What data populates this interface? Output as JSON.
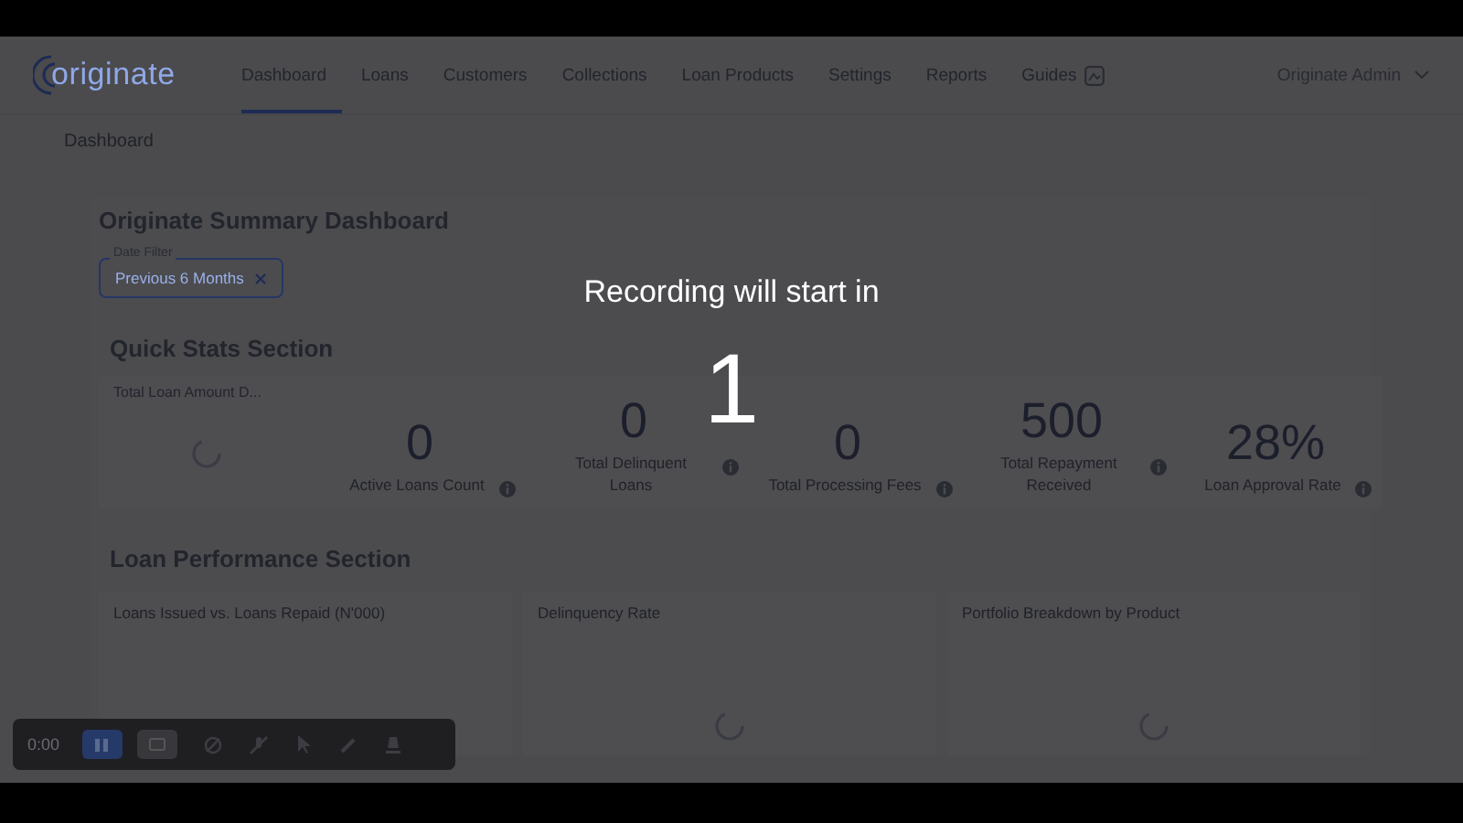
{
  "app": {
    "logo": "originate"
  },
  "nav": [
    {
      "label": "Dashboard",
      "selected": true,
      "has_icon": false
    },
    {
      "label": "Loans",
      "selected": false,
      "has_icon": false
    },
    {
      "label": "Customers",
      "selected": false,
      "has_icon": false
    },
    {
      "label": "Collections",
      "selected": false,
      "has_icon": false
    },
    {
      "label": "Loan Products",
      "selected": false,
      "has_icon": false
    },
    {
      "label": "Settings",
      "selected": false,
      "has_icon": false
    },
    {
      "label": "Reports",
      "selected": false,
      "has_icon": false
    },
    {
      "label": "Guides",
      "selected": false,
      "has_icon": true
    }
  ],
  "user_menu": {
    "label": "Originate Admin"
  },
  "breadcrumb": "Dashboard",
  "page_title": "Originate Summary Dashboard",
  "date_filter": {
    "label": "Date Filter",
    "value": "Previous 6 Months"
  },
  "quick_stats": {
    "title": "Quick Stats Section",
    "loading_card": {
      "title": "Total Loan Amount D..."
    },
    "stats": [
      {
        "value": "0",
        "label": "Active Loans Count"
      },
      {
        "value": "0",
        "label": "Total Delinquent Loans"
      },
      {
        "value": "0",
        "label": "Total Processing Fees"
      },
      {
        "value": "500",
        "label": "Total Repayment Received"
      },
      {
        "value": "28%",
        "label": "Loan Approval Rate"
      }
    ]
  },
  "loan_performance": {
    "title": "Loan Performance Section",
    "charts": [
      {
        "title": "Loans Issued vs. Loans Repaid (N'000)"
      },
      {
        "title": "Delinquency Rate"
      },
      {
        "title": "Portfolio Breakdown by Product"
      }
    ]
  },
  "recording_overlay": {
    "message": "Recording will start in",
    "countdown": "1"
  },
  "recorder_toolbar": {
    "timer": "0:00"
  }
}
